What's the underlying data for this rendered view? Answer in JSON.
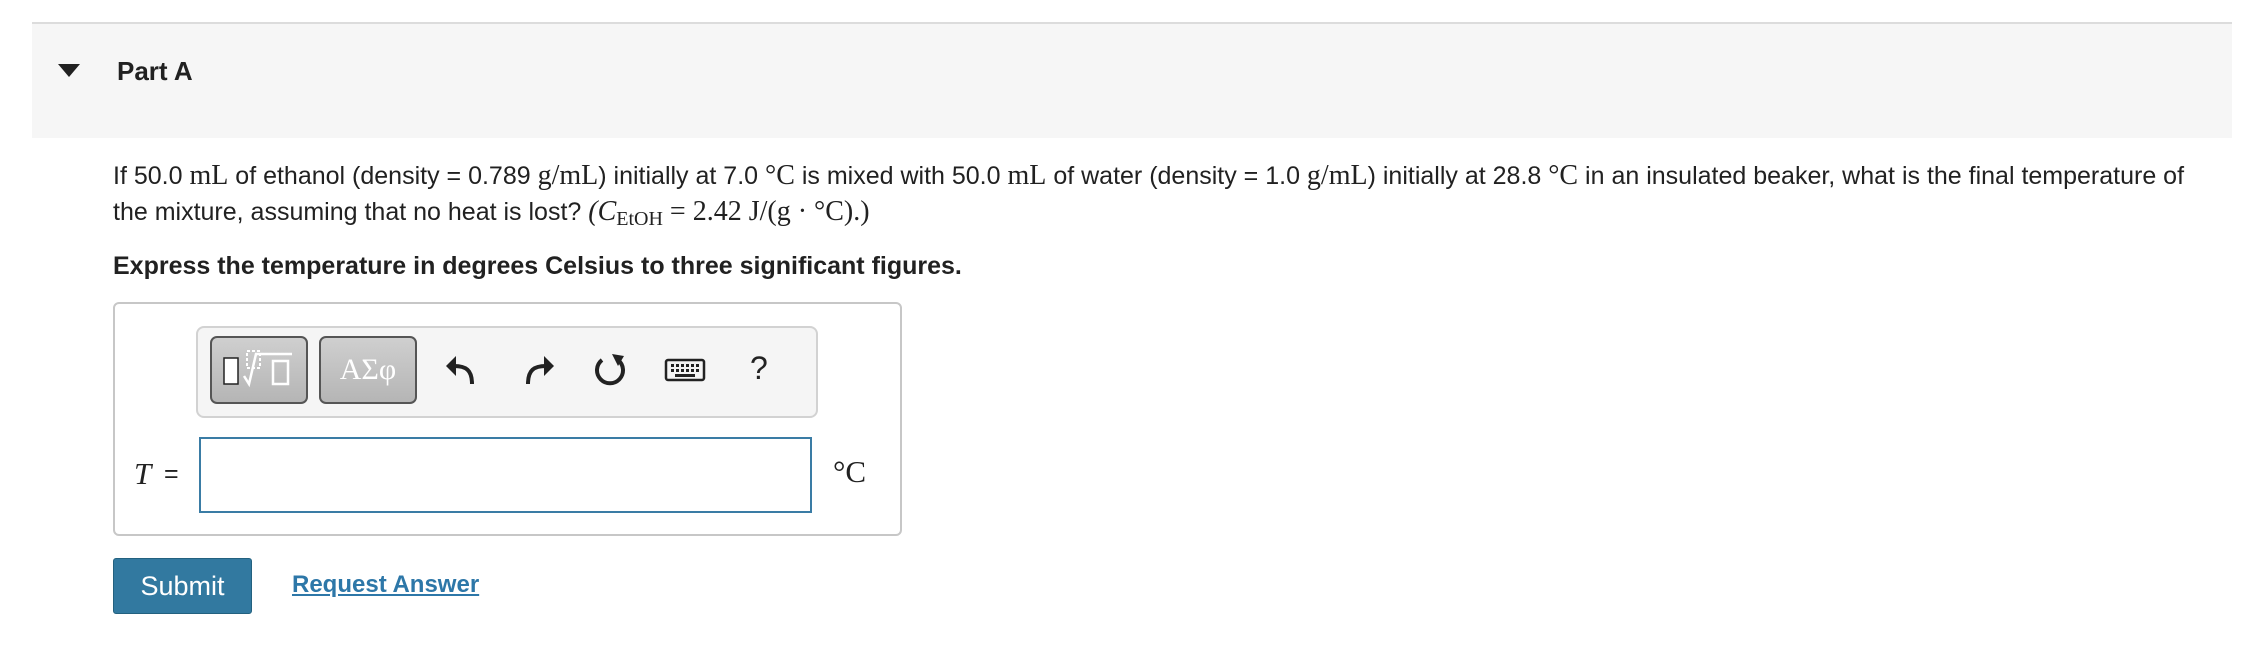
{
  "part": {
    "title": "Part A"
  },
  "question": {
    "t1": "If 50.0 ",
    "u_mL1": "mL",
    "t2": " of ethanol (density = 0.789 ",
    "u_gmL1": "g/mL",
    "t3": ") initially at 7.0 ",
    "u_degC1": "°C",
    "t4": " is mixed with 50.0 ",
    "u_mL2": "mL",
    "t5": " of water (density = 1.0 ",
    "u_gmL2": "g/mL",
    "t6": ") initially at 28.8 ",
    "u_degC2": "°C",
    "t7": " in an insulated beaker, what is the final temperature of the mixture, assuming that no heat is lost? ",
    "formula_open": "(C",
    "formula_sub": "EtOH",
    "formula_rest": " = 2.42 J/(g · °C).)"
  },
  "instruction": "Express the temperature in degrees Celsius to three significant figures.",
  "toolbar": {
    "templates_icon": "templates-icon",
    "symbols_label": "ΑΣφ",
    "undo_icon": "undo-icon",
    "redo_icon": "redo-icon",
    "reset_icon": "reset-icon",
    "keyboard_icon": "keyboard-icon",
    "help_label": "?"
  },
  "answer": {
    "variable": "T",
    "equals": "=",
    "value": "",
    "unit": "°C"
  },
  "actions": {
    "submit_label": "Submit",
    "request_label": "Request Answer"
  },
  "colors": {
    "submit_bg": "#3279a0",
    "link": "#2d77a8",
    "input_border": "#3a7ca5",
    "header_bg": "#f6f6f6"
  }
}
